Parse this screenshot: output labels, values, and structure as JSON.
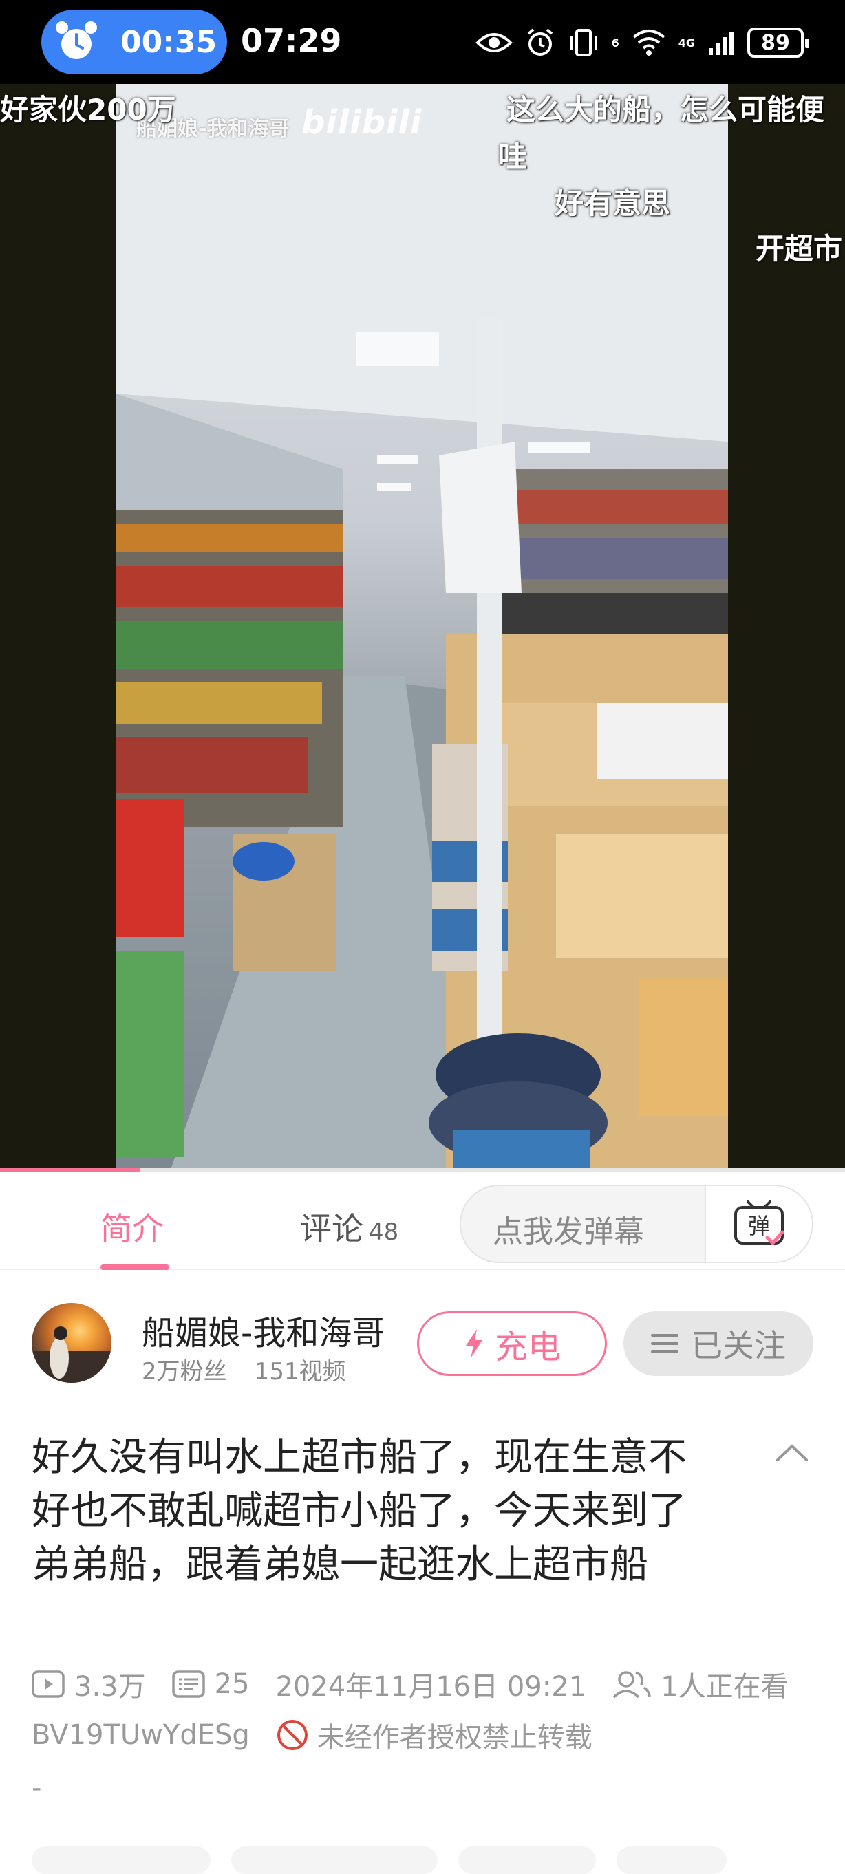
{
  "status_bar": {
    "timer": "00:35",
    "clock": "07:29",
    "network": "4G",
    "sim": "6",
    "battery": "89"
  },
  "video": {
    "watermark_uploader": "船媚娘-我和海哥",
    "watermark_logo": "bilibili",
    "danmaku": [
      "好家伙200万",
      "这么大的船，怎么可能便",
      "哇",
      "好有意思",
      "开超市"
    ],
    "progress_fraction": 0.165
  },
  "tabs": {
    "intro": "简介",
    "comments": "评论",
    "comments_count": "48",
    "danmaku_placeholder": "点我发弹幕",
    "danmaku_toggle": "弹"
  },
  "uploader": {
    "name": "船媚娘-我和海哥",
    "fans": "2万粉丝",
    "videos": "151视频",
    "charge_label": "充电",
    "follow_label": "已关注"
  },
  "description": {
    "title": "好久没有叫水上超市船了，现在生意不好也不敢乱喊超市小船了，今天来到了弟弟船，跟着弟媳一起逛水上超市船",
    "views": "3.3万",
    "danmaku_count": "25",
    "publish_time": "2024年11月16日 09:21",
    "watching": "1人正在看",
    "bvid": "BV19TUwYdESg",
    "repost_notice": "未经作者授权禁止转载",
    "extra": "-"
  },
  "colors": {
    "accent": "#fb7299",
    "timer_pill": "#3b82f6"
  }
}
